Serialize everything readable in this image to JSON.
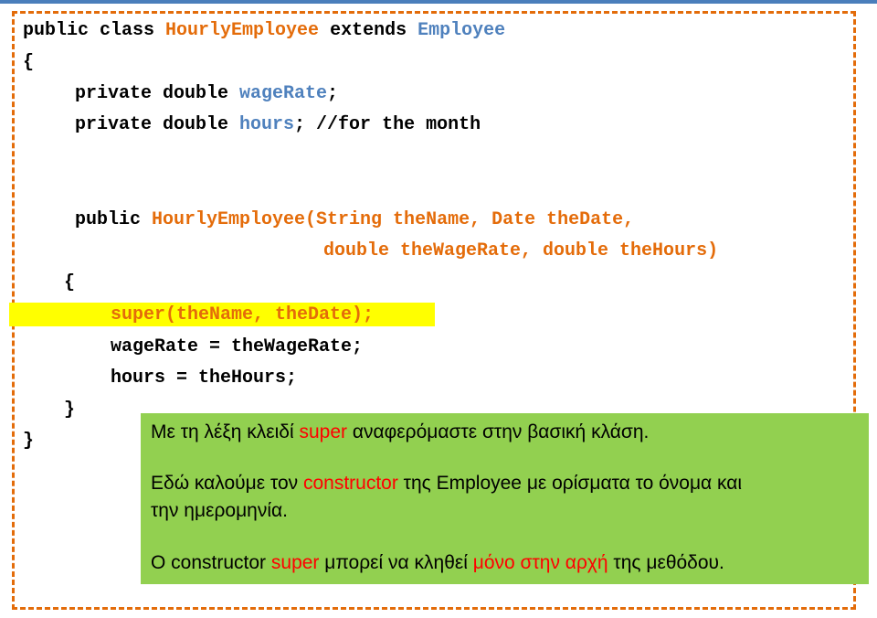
{
  "code": {
    "l1_kw": "public class ",
    "l1_cls": "HourlyEmployee",
    "l1_ext": " extends ",
    "l1_base": "Employee",
    "l2": "{",
    "l3_kw": "private double ",
    "l3_var": "wageRate",
    "l3_end": ";",
    "l4_kw": "private double ",
    "l4_var": "hours",
    "l4_end": "; //for the month",
    "l5_kw": "public ",
    "l5_sig": "HourlyEmployee(String theName, Date theDate,",
    "l6_sig": "double theWageRate, double theHours)",
    "l7": "{",
    "l8": "super(theName, theDate);",
    "l9": "wageRate = theWageRate;",
    "l10": "hours = theHours;",
    "l11": "}",
    "l12": "}"
  },
  "note": {
    "p1_a": "Με τη λέξη κλειδί ",
    "p1_b": "super",
    "p1_c": " αναφερόμαστε στην βασική κλάση.",
    "p2_a": "Εδώ καλούμε τον ",
    "p2_b": "constructor",
    "p2_c": " της Employee με ορίσματα το όνομα και",
    "p2_d": "την ημερομηνία.",
    "p3_a": "Ο constructor ",
    "p3_b": "super",
    "p3_c": " μπορεί να κληθεί ",
    "p3_d": "μόνο στην αρχή",
    "p3_e": " της μεθόδου."
  },
  "colors": {
    "keyword": "#000000",
    "identifier": "#4f81bd",
    "class_name": "#e46c0a",
    "highlight": "#ffff00",
    "note_bg": "#92d050",
    "note_emphasis": "#ff0000",
    "frame": "#e36c0a"
  }
}
